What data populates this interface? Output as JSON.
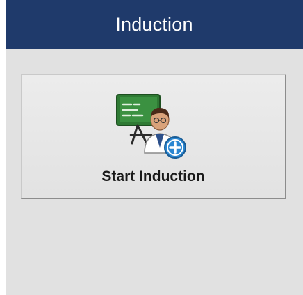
{
  "header": {
    "title": "Induction"
  },
  "start_button": {
    "label": "Start Induction",
    "icon": "trainer-with-board-add-icon"
  },
  "colors": {
    "header_bg": "#1f3a6b",
    "header_text": "#ffffff",
    "panel_bg": "#e1e1e1",
    "board_green": "#2f7a34",
    "add_badge": "#2a86d1"
  }
}
